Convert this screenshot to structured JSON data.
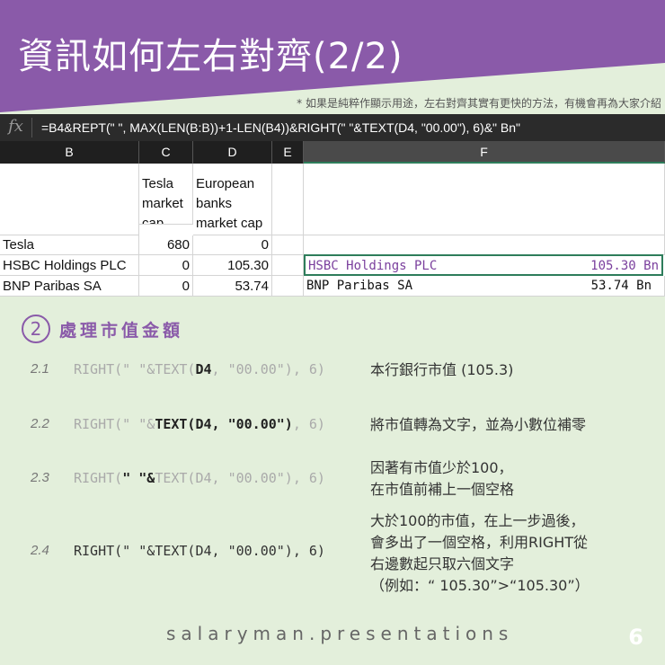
{
  "title": "資訊如何左右對齊(2/2)",
  "note": "* 如果是純粹作顯示用途，左右對齊其實有更快的方法，有機會再為大家介紹",
  "formula_bar": {
    "icon": "fx",
    "formula": "=B4&REPT(\" \", MAX(LEN(B:B))+1-LEN(B4))&RIGHT(\" \"&TEXT(D4, \"00.00\"), 6)&\" Bn\""
  },
  "columns": [
    "B",
    "C",
    "D",
    "E",
    "F"
  ],
  "sheet": {
    "header": {
      "c": "Tesla market cap",
      "d": "European banks market cap"
    },
    "rows": [
      {
        "b": "Tesla",
        "c": "680",
        "d": "0",
        "f": ""
      },
      {
        "b": "HSBC Holdings PLC",
        "c": "0",
        "d": "105.30",
        "f_name": "HSBC Holdings PLC",
        "f_val": "105.30 Bn"
      },
      {
        "b": "BNP Paribas SA",
        "c": "0",
        "d": "53.74",
        "f_name": "BNP Paribas SA",
        "f_val": "53.74 Bn"
      }
    ]
  },
  "section": {
    "number": "2",
    "title": "處理市值金額"
  },
  "steps": [
    {
      "num": "2.1",
      "segments": [
        {
          "t": "RIGHT(\" \"&TEXT(",
          "s": "dim"
        },
        {
          "t": "D4",
          "s": "bld"
        },
        {
          "t": ", \"00.00\"), 6)",
          "s": "dim"
        }
      ],
      "desc": [
        "本行銀行市值 (105.3)"
      ]
    },
    {
      "num": "2.2",
      "segments": [
        {
          "t": "RIGHT(\" \"&",
          "s": "dim"
        },
        {
          "t": "TEXT(D4, \"00.00\")",
          "s": "bld"
        },
        {
          "t": ", 6)",
          "s": "dim"
        }
      ],
      "desc": [
        "將市值轉為文字，並為小數位補零"
      ]
    },
    {
      "num": "2.3",
      "segments": [
        {
          "t": "RIGHT(",
          "s": "dim"
        },
        {
          "t": "\" \"&",
          "s": "bld"
        },
        {
          "t": "TEXT(D4, \"00.00\"), 6)",
          "s": "dim"
        }
      ],
      "desc": [
        "因著有市值少於100，",
        "在市值前補上一個空格"
      ]
    },
    {
      "num": "2.4",
      "segments": [
        {
          "t": "RIGHT(\" \"&TEXT(D4, \"00.00\"), 6)",
          "s": "nrm"
        }
      ],
      "desc": [
        "大於100的市值，在上一步過後，",
        "會多出了一個空格，利用RIGHT從",
        "右邊數起只取六個文字",
        "（例如：“ 105.30”>“105.30”）"
      ]
    }
  ],
  "footer": "salaryman.presentations",
  "page_number": "6",
  "colors": {
    "purple": "#8a5aa9",
    "green_bg": "#e3efdb",
    "selected_border": "#2e7d5b"
  }
}
